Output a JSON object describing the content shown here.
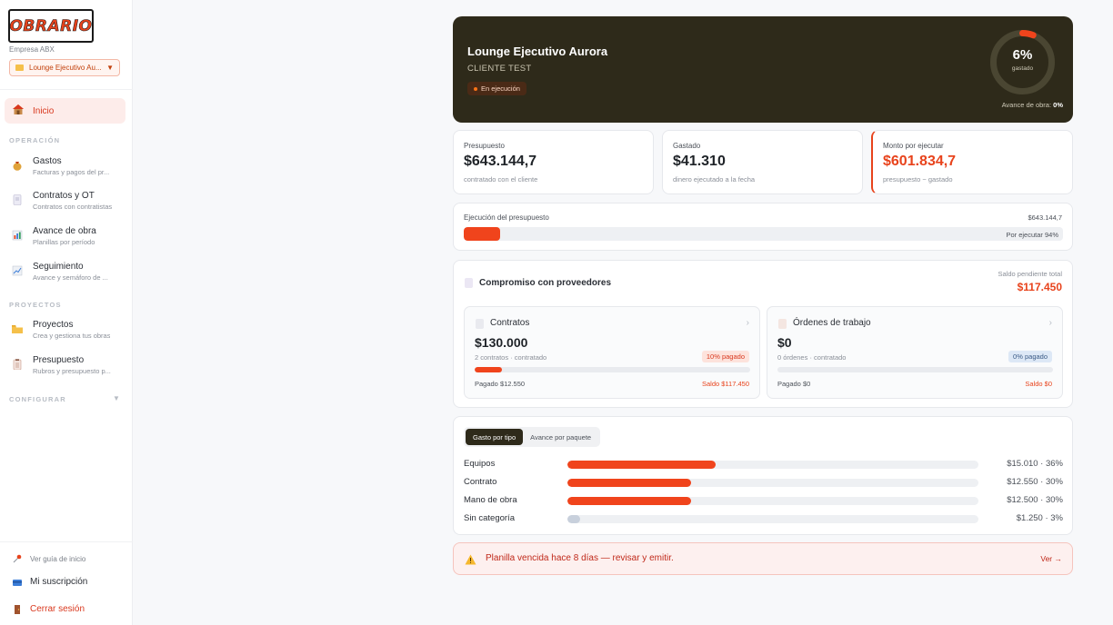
{
  "sidebar": {
    "logo_text": "OBRARIO",
    "company": "Empresa ABX",
    "project_select": "Lounge Ejecutivo Au...",
    "home": "Inicio",
    "sections": {
      "operacion": "OPERACIÓN",
      "proyectos": "PROYECTOS",
      "configurar": "CONFIGURAR"
    },
    "operacion_items": [
      {
        "title": "Gastos",
        "sub": "Facturas y pagos del pr...",
        "icon": "money-bag-icon"
      },
      {
        "title": "Contratos y OT",
        "sub": "Contratos con contratistas",
        "icon": "document-icon"
      },
      {
        "title": "Avance de obra",
        "sub": "Planillas por período",
        "icon": "bar-chart-icon"
      },
      {
        "title": "Seguimiento",
        "sub": "Avance y semáforo de ...",
        "icon": "trend-chart-icon"
      }
    ],
    "proyectos_items": [
      {
        "title": "Proyectos",
        "sub": "Crea y gestiona tus obras",
        "icon": "folder-icon"
      },
      {
        "title": "Presupuesto",
        "sub": "Rubros y presupuesto p...",
        "icon": "clipboard-icon"
      }
    ],
    "footer": {
      "guide": "Ver guía de inicio",
      "subscription": "Mi suscripción",
      "logout": "Cerrar sesión"
    }
  },
  "hero": {
    "title": "Lounge Ejecutivo Aurora",
    "client": "CLIENTE TEST",
    "status": "En ejecución",
    "spent_pct": 6,
    "spent_pct_label": "6%",
    "spent_label": "gastado",
    "progress_label": "Avance de obra:",
    "progress_value": "0%"
  },
  "stats": [
    {
      "label": "Presupuesto",
      "value": "$643.144,7",
      "sub": "contratado con el cliente"
    },
    {
      "label": "Gastado",
      "value": "$41.310",
      "sub": "dinero ejecutado a la fecha"
    },
    {
      "label": "Monto por ejecutar",
      "value": "$601.834,7",
      "sub": "presupuesto − gastado"
    }
  ],
  "execution": {
    "label": "Ejecución del presupuesto",
    "amount": "$643.144,7",
    "executed_pct": 6,
    "remaining_label": "Por ejecutar 94%"
  },
  "commitment": {
    "title": "Compromiso con proveedores",
    "pending_label": "Saldo pendiente total",
    "pending_value": "$117.450",
    "cards": [
      {
        "title": "Contratos",
        "value": "$130.000",
        "meta": "2 contratos · contratado",
        "badge": "10% pagado",
        "paid_pct": 10,
        "paid": "Pagado $12.550",
        "balance": "Saldo $117.450"
      },
      {
        "title": "Órdenes de trabajo",
        "value": "$0",
        "meta": "0 órdenes · contratado",
        "badge": "0% pagado",
        "paid_pct": 0,
        "paid": "Pagado $0",
        "balance": "Saldo $0"
      }
    ]
  },
  "breakdown": {
    "tabs": [
      "Gasto por tipo",
      "Avance por paquete"
    ],
    "active_tab": "Gasto por tipo",
    "rows": [
      {
        "name": "Equipos",
        "pct": 36,
        "amount": "$15.010 · 36%",
        "color": "#f0441c"
      },
      {
        "name": "Contrato",
        "pct": 30,
        "amount": "$12.550 · 30%",
        "color": "#f0441c"
      },
      {
        "name": "Mano de obra",
        "pct": 30,
        "amount": "$12.500 · 30%",
        "color": "#f0441c"
      },
      {
        "name": "Sin categoría",
        "pct": 3,
        "amount": "$1.250 · 3%",
        "color": "#c8d0dc"
      }
    ]
  },
  "alert": {
    "message": "Planilla vencida hace 8 días — revisar y emitir.",
    "action": "Ver →"
  },
  "colors": {
    "accent": "#e8431c",
    "dark": "#2e2a1a"
  }
}
